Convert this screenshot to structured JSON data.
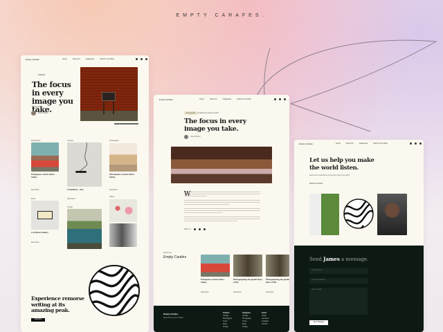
{
  "brand_title": "EMPTY CARAFES.",
  "nav": {
    "logo": "Empty Carafes",
    "items": [
      "Home",
      "About Us",
      "Categories",
      "Submit Your Work"
    ]
  },
  "home": {
    "kicker": "Featured",
    "hero_title": "The focus in every image you take.",
    "meta": "Photography",
    "author": "James Parker",
    "cards": [
      {
        "category": "Photography",
        "title": "Portuguese streets with a hobby",
        "link": "Read More"
      },
      {
        "category": "Lifestyle",
        "title": "Complaints - Jazz",
        "link": "Read More"
      },
      {
        "category": "Photography",
        "title": "Old campers, travels with a hobby",
        "link": "Read More"
      },
      {
        "category": "Music",
        "title": "Lost Music Gallery",
        "link": "Read More"
      },
      {
        "category": "Vintage",
        "title": "",
        "link": ""
      },
      {
        "category": "Nature",
        "title": "",
        "link": ""
      }
    ],
    "cta_title": "Experience remorse writing at its amazing peak.",
    "cta_button": "Subscribe"
  },
  "article": {
    "tag": "Photography",
    "date": "Published by Empty Carafes",
    "title": "The focus in every image you take.",
    "author": "James Parker",
    "dropcap": "W",
    "share_label": "Share on",
    "related_kicker": "Read more",
    "related_title": "Empty Carafes",
    "related": [
      {
        "title": "Portuguese streets with a hobby",
        "link": "Read More"
      },
      {
        "title": "Photographing the global faces of life",
        "link": "Read More"
      },
      {
        "title": "Photographing the global faces of life",
        "link": "Read More"
      }
    ],
    "footer": {
      "logo": "Empty Carafes.",
      "made_by": "Made with ♥ by Anni Studios",
      "cols": [
        {
          "title": "Features",
          "items": [
            "Lifestyle",
            "Photography",
            "Travel",
            "Music",
            "Vintage"
          ]
        },
        {
          "title": "Categories",
          "items": [
            "Lifestyle",
            "Photography",
            "Travel",
            "Music",
            "Vintage"
          ]
        },
        {
          "title": "Social",
          "items": [
            "Twitter",
            "Facebook",
            "Instagram",
            "LinkedIn"
          ]
        }
      ]
    }
  },
  "contact": {
    "title": "Let us help you make the world listen.",
    "subtitle": "Send us an email and let us get your work to the world.",
    "submit": "Submit Your Work",
    "form_title_pre": "Send ",
    "form_title_name": "James",
    "form_title_post": " a message.",
    "name_placeholder": "Your full name",
    "email_placeholder": "Your email address",
    "message_placeholder": "Your message",
    "send_button": "Send Message"
  }
}
